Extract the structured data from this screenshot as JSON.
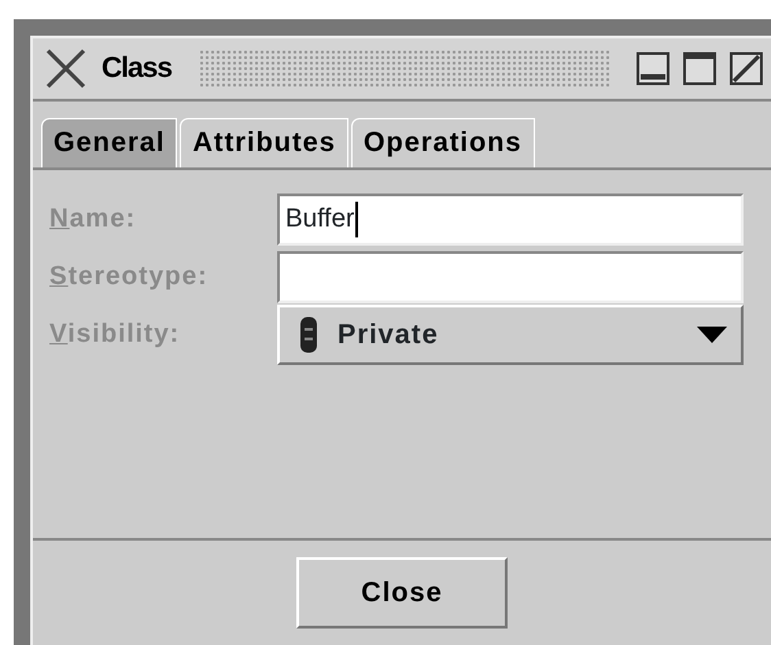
{
  "window": {
    "title": "Class"
  },
  "tabs": [
    {
      "label": "General",
      "selected": true
    },
    {
      "label": "Attributes",
      "selected": false
    },
    {
      "label": "Operations",
      "selected": false
    }
  ],
  "fields": [
    {
      "kind": "text",
      "label": "Name:",
      "value": "Buffer",
      "focused": true
    },
    {
      "kind": "text",
      "label": "Stereotype:",
      "focused": false
    },
    {
      "kind": "dropdown",
      "label": "Visibility:",
      "value": "Private"
    }
  ],
  "buttons": [
    "Close"
  ]
}
